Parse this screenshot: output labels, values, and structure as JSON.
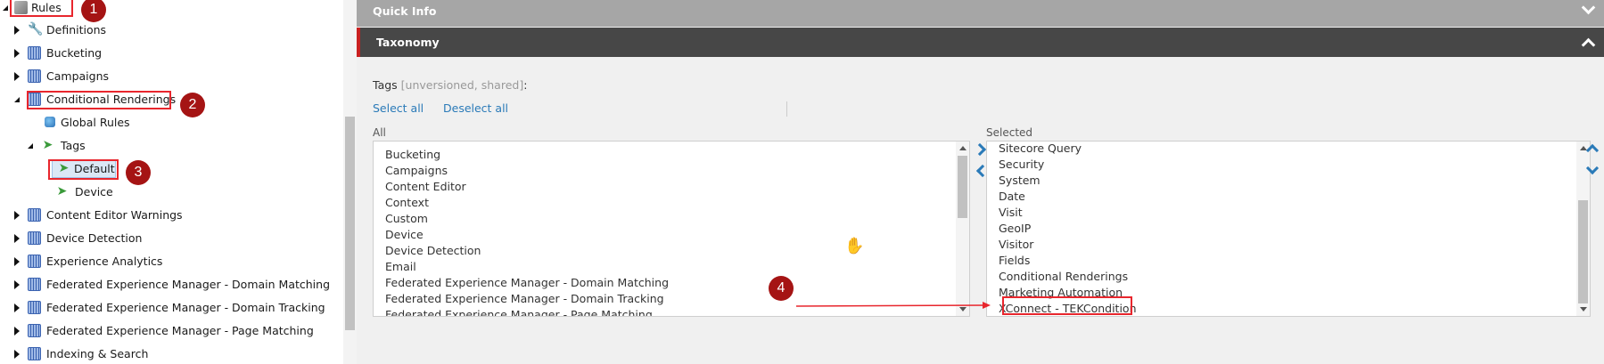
{
  "tree": {
    "root": {
      "label": "Rules"
    },
    "items": [
      {
        "label": "Definitions"
      },
      {
        "label": "Bucketing"
      },
      {
        "label": "Campaigns"
      },
      {
        "label": "Conditional Renderings"
      },
      {
        "label": "Global Rules"
      },
      {
        "label": "Tags"
      },
      {
        "label": "Default"
      },
      {
        "label": "Device"
      },
      {
        "label": "Content Editor Warnings"
      },
      {
        "label": "Device Detection"
      },
      {
        "label": "Experience Analytics"
      },
      {
        "label": "Federated Experience Manager - Domain Matching"
      },
      {
        "label": "Federated Experience Manager - Domain Tracking"
      },
      {
        "label": "Federated Experience Manager - Page Matching"
      },
      {
        "label": "Indexing & Search"
      }
    ]
  },
  "annotations": {
    "badges": [
      "1",
      "2",
      "3",
      "4"
    ],
    "accent": "#e8262d",
    "badge_color": "#a51414"
  },
  "sections": {
    "quick_info": "Quick Info",
    "taxonomy": "Taxonomy"
  },
  "field": {
    "label": "Tags",
    "meta": "[unversioned, shared]",
    "colon": ":",
    "select_all": "Select all",
    "deselect_all": "Deselect all"
  },
  "lists": {
    "all_caption": "All",
    "selected_caption": "Selected",
    "all_items": [
      "Bucketing",
      "Campaigns",
      "Content Editor",
      "Context",
      "Custom",
      "Device",
      "Device Detection",
      "Email",
      "Federated Experience Manager - Domain Matching",
      "Federated Experience Manager - Domain Tracking",
      "Federated Experience Manager - Page Matching"
    ],
    "selected_items": [
      "Sitecore Query",
      "Security",
      "System",
      "Date",
      "Visit",
      "GeoIP",
      "Visitor",
      "Fields",
      "Conditional Renderings",
      "Marketing Automation",
      "XConnect - TEKCondition"
    ]
  },
  "colors": {
    "link": "#2a7ab8",
    "header_dark": "#474747",
    "header_light": "#a6a6a6"
  }
}
